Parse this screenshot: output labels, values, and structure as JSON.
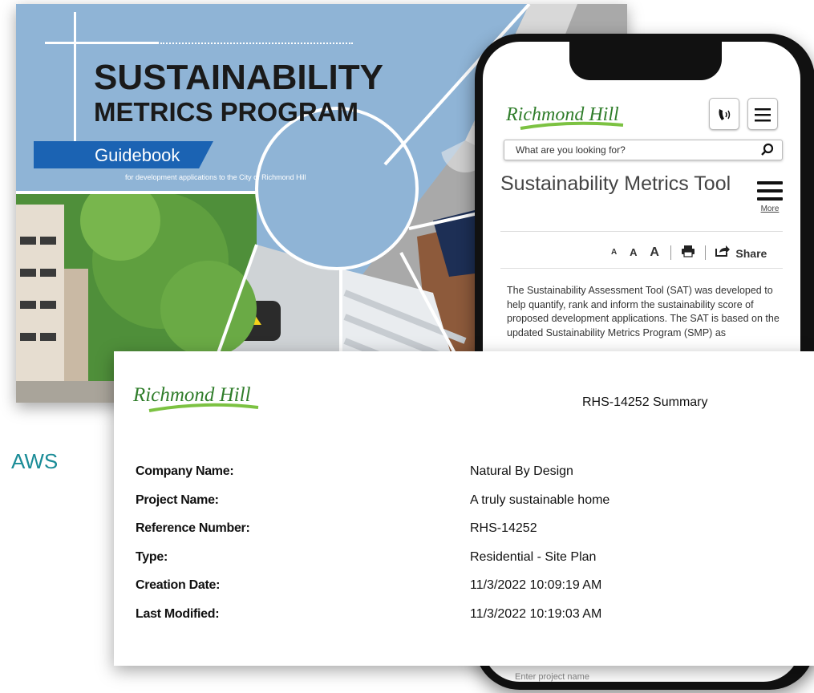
{
  "cover": {
    "title_line1": "SUSTAINABILITY",
    "title_line2": "METRICS PROGRAM",
    "band_label": "Guidebook",
    "subtitle": "for development applications to the City of Richmond Hill"
  },
  "side_heading_fragment": "AWS",
  "phone": {
    "logo_text": "Richmond Hill",
    "phone_icon": "phone-icon",
    "menu_icon": "hamburger-icon",
    "search_placeholder": "What are you looking for?",
    "page_title": "Sustainability Metrics Tool",
    "more_label": "More",
    "text_size_small": "A",
    "text_size_medium": "A",
    "text_size_large": "A",
    "share_label": "Share",
    "body_text": "The Sustainability Assessment Tool (SAT) was developed to help quantify, rank and inform the sustainability score of proposed development applications. The SAT is based on the updated Sustainability Metrics Program (SMP) as",
    "bottom_input_placeholder": "Enter project name"
  },
  "summary": {
    "logo_text": "Richmond Hill",
    "title": "RHS-14252 Summary",
    "fields": [
      {
        "label": "Company Name:",
        "value": "Natural By Design"
      },
      {
        "label": "Project Name:",
        "value": "A truly sustainable home"
      },
      {
        "label": "Reference Number:",
        "value": "RHS-14252"
      },
      {
        "label": "Type:",
        "value": "Residential - Site Plan"
      },
      {
        "label": "Creation Date:",
        "value": "11/3/2022 10:09:19 AM"
      },
      {
        "label": "Last Modified:",
        "value": "11/3/2022 10:19:03 AM"
      }
    ]
  },
  "colors": {
    "cover_blue": "#8fb4d6",
    "band_blue": "#1b63b3",
    "logo_green": "#3a8a2e",
    "side_teal": "#1a8c97"
  }
}
